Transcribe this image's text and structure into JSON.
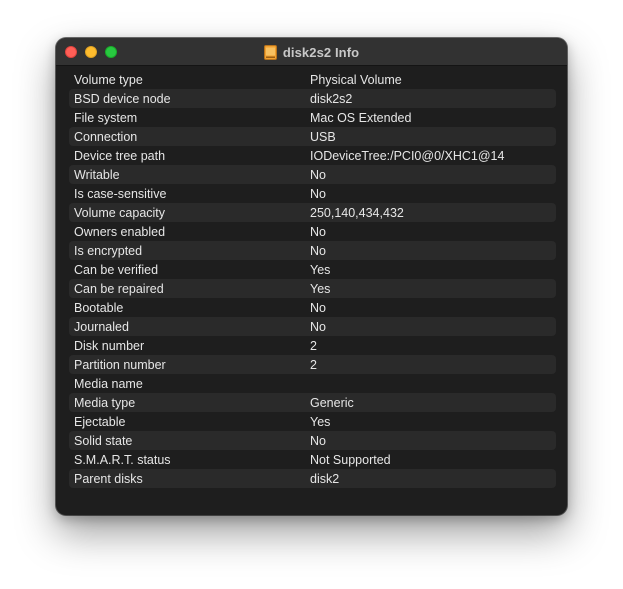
{
  "window": {
    "title": "disk2s2 Info",
    "title_icon": "external-drive-icon",
    "colors": {
      "background": "#1e1e1e",
      "titlebar": "#323232",
      "row_alt": "#2a2a2a",
      "text": "#e6e6e6",
      "close": "#ff5f57",
      "minimize": "#febc2e",
      "zoom": "#28c840",
      "drive_icon": "#f0a030"
    }
  },
  "rows": [
    {
      "key": "Volume type",
      "value": "Physical Volume"
    },
    {
      "key": "BSD device node",
      "value": "disk2s2"
    },
    {
      "key": "File system",
      "value": "Mac OS Extended"
    },
    {
      "key": "Connection",
      "value": "USB"
    },
    {
      "key": "Device tree path",
      "value": "IODeviceTree:/PCI0@0/XHC1@14"
    },
    {
      "key": "Writable",
      "value": "No"
    },
    {
      "key": "Is case-sensitive",
      "value": "No"
    },
    {
      "key": "Volume capacity",
      "value": "250,140,434,432"
    },
    {
      "key": "Owners enabled",
      "value": "No"
    },
    {
      "key": "Is encrypted",
      "value": "No"
    },
    {
      "key": "Can be verified",
      "value": "Yes"
    },
    {
      "key": "Can be repaired",
      "value": "Yes"
    },
    {
      "key": "Bootable",
      "value": "No"
    },
    {
      "key": "Journaled",
      "value": "No"
    },
    {
      "key": "Disk number",
      "value": "2"
    },
    {
      "key": "Partition number",
      "value": "2"
    },
    {
      "key": "Media name",
      "value": ""
    },
    {
      "key": "Media type",
      "value": "Generic"
    },
    {
      "key": "Ejectable",
      "value": "Yes"
    },
    {
      "key": "Solid state",
      "value": "No"
    },
    {
      "key": "S.M.A.R.T. status",
      "value": "Not Supported"
    },
    {
      "key": "Parent disks",
      "value": "disk2"
    }
  ]
}
